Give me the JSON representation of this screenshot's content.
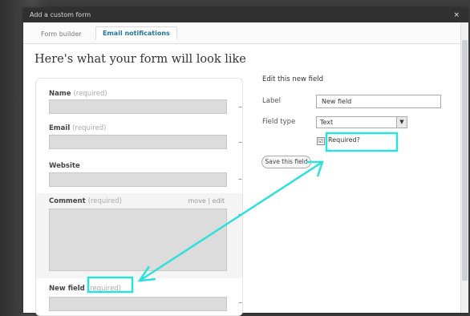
{
  "dialog": {
    "title": "Add a custom form",
    "close": "×"
  },
  "tabs": [
    {
      "label": "Form builder"
    },
    {
      "label": "Email notifications"
    }
  ],
  "heading": "Here's what your form will look like",
  "form": {
    "fields": [
      {
        "label": "Name",
        "required": "(required)"
      },
      {
        "label": "Email",
        "required": "(required)"
      },
      {
        "label": "Website",
        "required": ""
      },
      {
        "label": "Comment",
        "required": "(required)",
        "move": "move",
        "sep": "|",
        "edit": "edit"
      },
      {
        "label": "New field",
        "required": "(required)"
      }
    ],
    "remove": "–"
  },
  "editor": {
    "heading": "Edit this new field",
    "label_caption": "Label",
    "label_value": "New field",
    "type_caption": "Field type",
    "type_value": "Text",
    "required_label": "Required?",
    "required_checked": "☑",
    "save_label": "Save this field"
  },
  "annotation": {
    "color": "#2ee0dc"
  }
}
